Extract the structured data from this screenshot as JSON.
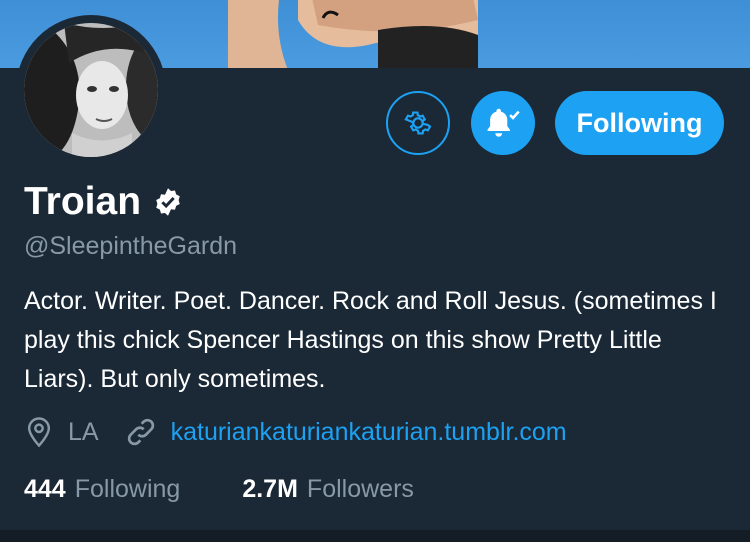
{
  "profile": {
    "name": "Troian",
    "handle": "@SleepintheGardn",
    "bio": "Actor. Writer. Poet. Dancer. Rock and Roll Jesus. (sometimes I play this chick Spencer Hastings on this show Pretty Little Liars). But only sometimes.",
    "location": "LA",
    "website": "katuriankaturiankaturian.tumblr.com",
    "verified": true
  },
  "actions": {
    "follow_label": "Following",
    "settings_icon": "gear-icon",
    "notifications_icon": "bell-check-icon"
  },
  "stats": {
    "following_count": "444",
    "following_label": "Following",
    "followers_count": "2.7M",
    "followers_label": "Followers"
  },
  "colors": {
    "background": "#1b2836",
    "accent": "#1da1f2",
    "secondary_text": "#8899a6",
    "banner_sky": "#4a9be0"
  }
}
